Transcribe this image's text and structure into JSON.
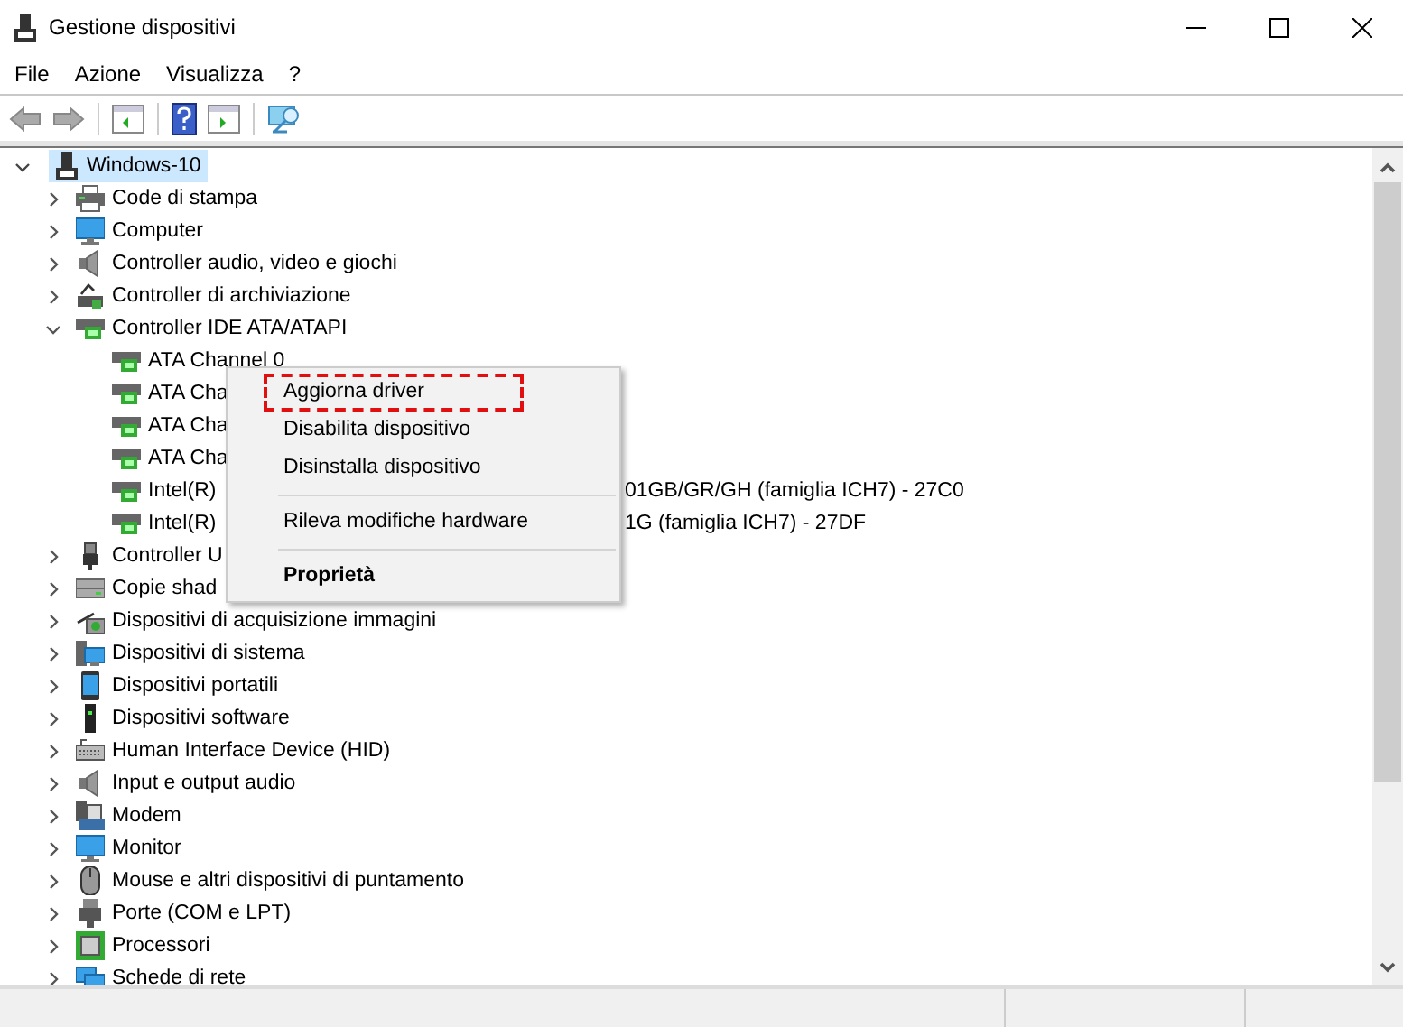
{
  "window": {
    "title": "Gestione dispositivi"
  },
  "menu_bar": [
    "File",
    "Azione",
    "Visualizza",
    "?"
  ],
  "tree": {
    "label": "Windows-10",
    "selected": true,
    "expanded": true,
    "children": [
      {
        "label": "Code di stampa",
        "expanded": false
      },
      {
        "label": "Computer",
        "expanded": false
      },
      {
        "label": "Controller audio, video e giochi",
        "expanded": false
      },
      {
        "label": "Controller di archiviazione",
        "expanded": false
      },
      {
        "label": "Controller IDE ATA/ATAPI",
        "expanded": true,
        "children": [
          {
            "label": "ATA Channel 0"
          },
          {
            "label": "ATA Cha"
          },
          {
            "label": "ATA Cha"
          },
          {
            "label": "ATA Cha"
          },
          {
            "label": "Intel(R)",
            "label_tail": "01GB/GR/GH (famiglia ICH7) - 27C0"
          },
          {
            "label": "Intel(R)",
            "label_tail": "1G (famiglia ICH7) - 27DF"
          }
        ]
      },
      {
        "label": "Controller U",
        "expanded": false
      },
      {
        "label": "Copie shad",
        "expanded": false
      },
      {
        "label": "Dispositivi di acquisizione immagini",
        "expanded": false
      },
      {
        "label": "Dispositivi di sistema",
        "expanded": false
      },
      {
        "label": "Dispositivi portatili",
        "expanded": false
      },
      {
        "label": "Dispositivi software",
        "expanded": false
      },
      {
        "label": "Human Interface Device (HID)",
        "expanded": false
      },
      {
        "label": "Input e output audio",
        "expanded": false
      },
      {
        "label": "Modem",
        "expanded": false
      },
      {
        "label": "Monitor",
        "expanded": false
      },
      {
        "label": "Mouse e altri dispositivi di puntamento",
        "expanded": false
      },
      {
        "label": "Porte (COM e LPT)",
        "expanded": false
      },
      {
        "label": "Processori",
        "expanded": false
      },
      {
        "label": "Schede di rete",
        "expanded": false
      }
    ]
  },
  "context_menu": [
    {
      "kind": "item",
      "label": "Aggiorna driver",
      "highlighted": true,
      "bold": false
    },
    {
      "kind": "item",
      "label": "Disabilita dispositivo",
      "highlighted": false,
      "bold": false
    },
    {
      "kind": "item",
      "label": "Disinstalla dispositivo",
      "highlighted": false,
      "bold": false
    },
    {
      "kind": "separator"
    },
    {
      "kind": "item",
      "label": "Rileva modifiche hardware",
      "highlighted": false,
      "bold": false
    },
    {
      "kind": "separator"
    },
    {
      "kind": "item",
      "label": "Proprietà",
      "highlighted": false,
      "bold": true
    }
  ]
}
